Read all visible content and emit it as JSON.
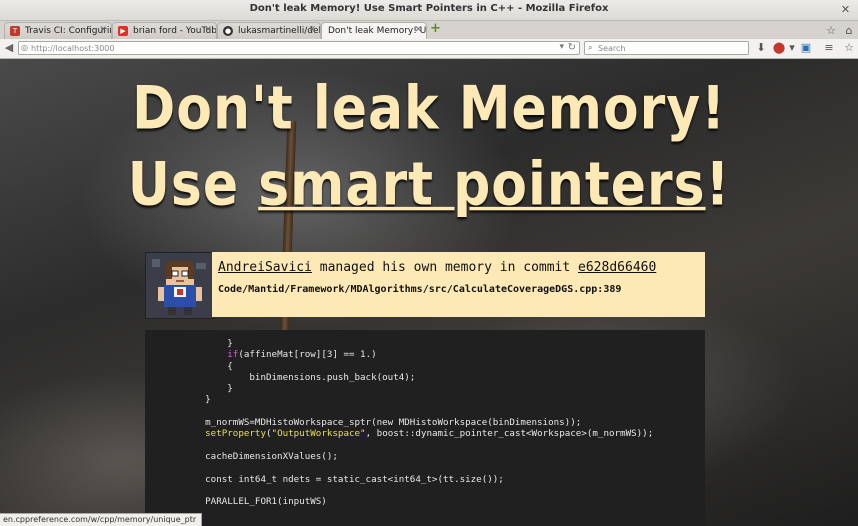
{
  "window": {
    "title": "Don't leak Memory! Use Smart Pointers in C++ - Mozilla Firefox"
  },
  "tabs": [
    {
      "label": "Travis CI: Configuring...",
      "icon": "travis-favicon"
    },
    {
      "label": "brian ford - YouTube",
      "icon": "youtube-favicon"
    },
    {
      "label": "lukasmartinelli/delptr",
      "icon": "github-favicon"
    },
    {
      "label": "Don't leak Memory! Use ...",
      "icon": "page-favicon"
    }
  ],
  "navbar": {
    "url": "http://localhost:3000",
    "search_placeholder": "Search"
  },
  "page": {
    "headline_line1": "Don't leak Memory!",
    "headline_line2_prefix": "Use ",
    "headline_line2_link": "smart pointers",
    "headline_line2_suffix": "!",
    "commit": {
      "author": "AndreiSavici",
      "middle_text": " managed his own memory in commit ",
      "hash": "e628d66460",
      "file_path": "Code/Mantid/Framework/MDAlgorithms/src/CalculateCoverageDGS.cpp:389"
    }
  },
  "status_bar": {
    "text": "en.cppreference.com/w/cpp/memory/unique_ptr"
  },
  "colors": {
    "headline": "#fde9b5",
    "commit_box": "#fde9b5",
    "code_background": "#202020",
    "keyword": "#d45ad4",
    "function": "#e4e04a"
  }
}
